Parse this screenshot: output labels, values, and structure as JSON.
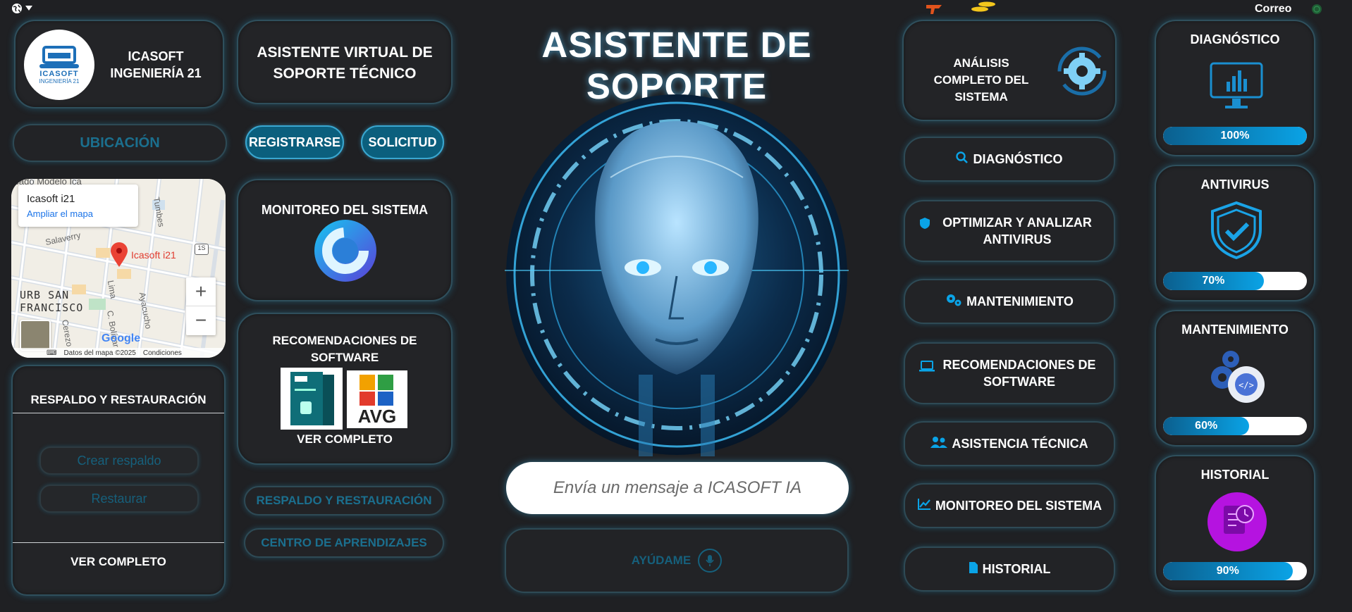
{
  "topbar": {
    "correo_label": "Correo"
  },
  "brand": {
    "logo_text": "ICASOFT",
    "logo_sub": "INGENIERÍA 21",
    "name": "ICASOFT INGENIERÍA 21"
  },
  "ubicacion_label": "UBICACIÓN",
  "map": {
    "place_name": "Icasoft i21",
    "enlarge_link": "Ampliar el mapa",
    "pin_label": "Icasoft i21",
    "top_label": "Mercado Modelo Ica",
    "district": "URB SAN FRANCISCO",
    "streets": [
      "Salaverry",
      "Tumbes",
      "Lima",
      "Ayacucho",
      "C. Bolívar",
      "Cerezo"
    ],
    "road_badge": "1S",
    "footer": "Datos del mapa ©2025",
    "terms": "Condiciones",
    "google": "Google"
  },
  "virtual_title": "ASISTENTE VIRTUAL DE SOPORTE TÉCNICO",
  "buttons": {
    "register": "REGISTRARSE",
    "request": "SOLICITUD"
  },
  "monitor_card": {
    "title": "MONITOREO DEL SISTEMA"
  },
  "software_card": {
    "title": "RECOMENDACIONES DE SOFTWARE",
    "see_all": "VER COMPLETO",
    "avg": "AVG"
  },
  "backup_card": {
    "title": "RESPALDO Y RESTAURACIÓN",
    "create": "Crear respaldo",
    "restore": "Restaurar",
    "see_all": "VER COMPLETO"
  },
  "mid_links": {
    "backup": "RESPALDO Y RESTAURACIÓN",
    "learning": "CENTRO DE APRENDIZAJES"
  },
  "main_title": "ASISTENTE DE SOPORTE",
  "chat": {
    "placeholder": "Envía un mensaje a ICASOFT IA",
    "help": "AYÚDAME"
  },
  "analysis": {
    "title": "ANÁLISIS COMPLETO DEL SISTEMA"
  },
  "menu": [
    {
      "label": "DIAGNÓSTICO",
      "icon": "search-icon"
    },
    {
      "label": "OPTIMIZAR Y ANALIZAR ANTIVIRUS",
      "icon": "shield-icon"
    },
    {
      "label": "MANTENIMIENTO",
      "icon": "gears-icon"
    },
    {
      "label": "RECOMENDACIONES DE SOFTWARE",
      "icon": "laptop-icon"
    },
    {
      "label": "ASISTENCIA TÉCNICA",
      "icon": "users-icon"
    },
    {
      "label": "MONITOREO DEL SISTEMA",
      "icon": "chart-icon"
    },
    {
      "label": "HISTORIAL",
      "icon": "file-icon"
    }
  ],
  "status": [
    {
      "title": "DIAGNÓSTICO",
      "percent": 100,
      "percent_label": "100%"
    },
    {
      "title": "ANTIVIRUS",
      "percent": 70,
      "percent_label": "70%"
    },
    {
      "title": "MANTENIMIENTO",
      "percent": 60,
      "percent_label": "60%"
    },
    {
      "title": "HISTORIAL",
      "percent": 90,
      "percent_label": "90%"
    }
  ],
  "colors": {
    "accent": "#0aa3e6",
    "bg": "#1f2023",
    "card_border": "#2f4f5c",
    "button_blue": "#0b5f7d"
  }
}
